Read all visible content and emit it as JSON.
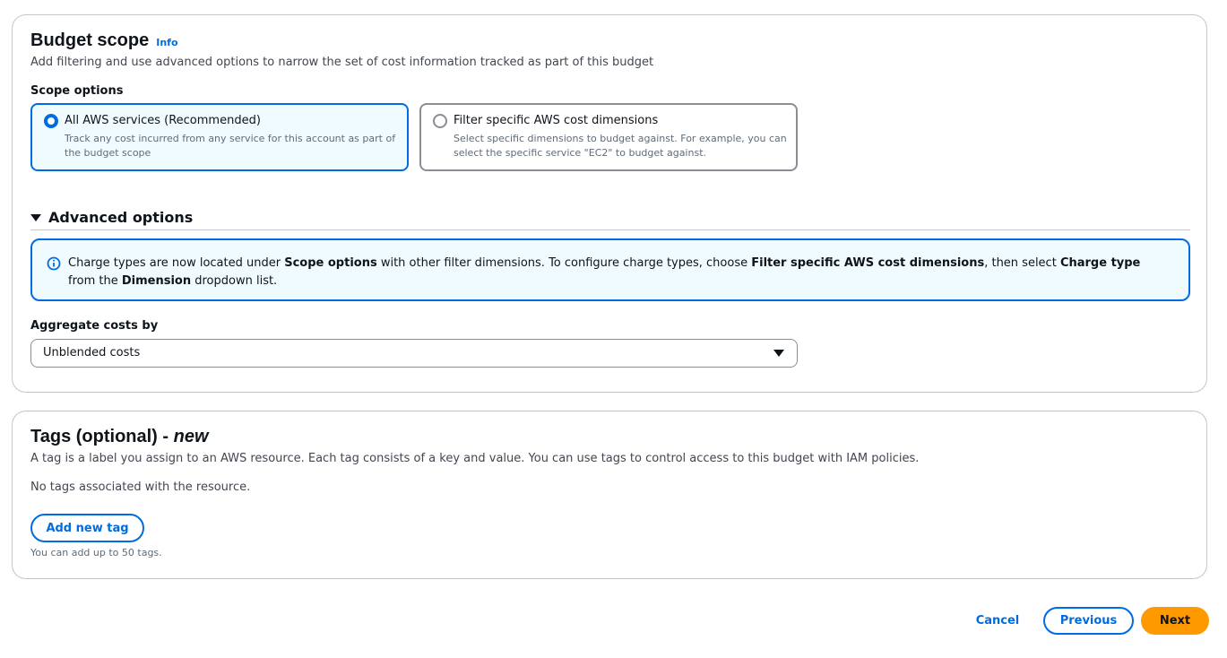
{
  "budget_scope": {
    "title": "Budget scope",
    "info_label": "Info",
    "description": "Add filtering and use advanced options to narrow the set of cost information tracked as part of this budget",
    "scope_options_label": "Scope options",
    "options": [
      {
        "title": "All AWS services (Recommended)",
        "description": "Track any cost incurred from any service for this account as part of the budget scope",
        "selected": true
      },
      {
        "title": "Filter specific AWS cost dimensions",
        "description": "Select specific dimensions to budget against. For example, you can select the specific service \"EC2\" to budget against.",
        "selected": false
      }
    ],
    "advanced": {
      "title": "Advanced options",
      "expanded": true,
      "alert": {
        "t1": "Charge types are now located under ",
        "b1": "Scope options",
        "t2": " with other filter dimensions. To configure charge types, choose ",
        "b2": "Filter specific AWS cost dimensions",
        "t3": ", then select ",
        "b3": "Charge type",
        "t4": " from the ",
        "b4": "Dimension",
        "t5": " dropdown list."
      },
      "aggregate_label": "Aggregate costs by",
      "aggregate_value": "Unblended costs"
    }
  },
  "tags": {
    "title": "Tags (optional)",
    "title_sep": " - ",
    "title_new": "new",
    "description": "A tag is a label you assign to an AWS resource. Each tag consists of a key and value. You can use tags to control access to this budget with IAM policies.",
    "empty_text": "No tags associated with the resource.",
    "add_button": "Add new tag",
    "hint": "You can add up to 50 tags."
  },
  "footer": {
    "cancel": "Cancel",
    "previous": "Previous",
    "next": "Next"
  },
  "colors": {
    "accent": "#006ce0",
    "primary_button": "#ff9900",
    "selected_tile_bg": "#f0fbff",
    "border": "#c6c6cd"
  },
  "icons": {
    "alert": "info-circle-icon",
    "expand": "caret-down-icon",
    "select": "caret-down-icon"
  }
}
